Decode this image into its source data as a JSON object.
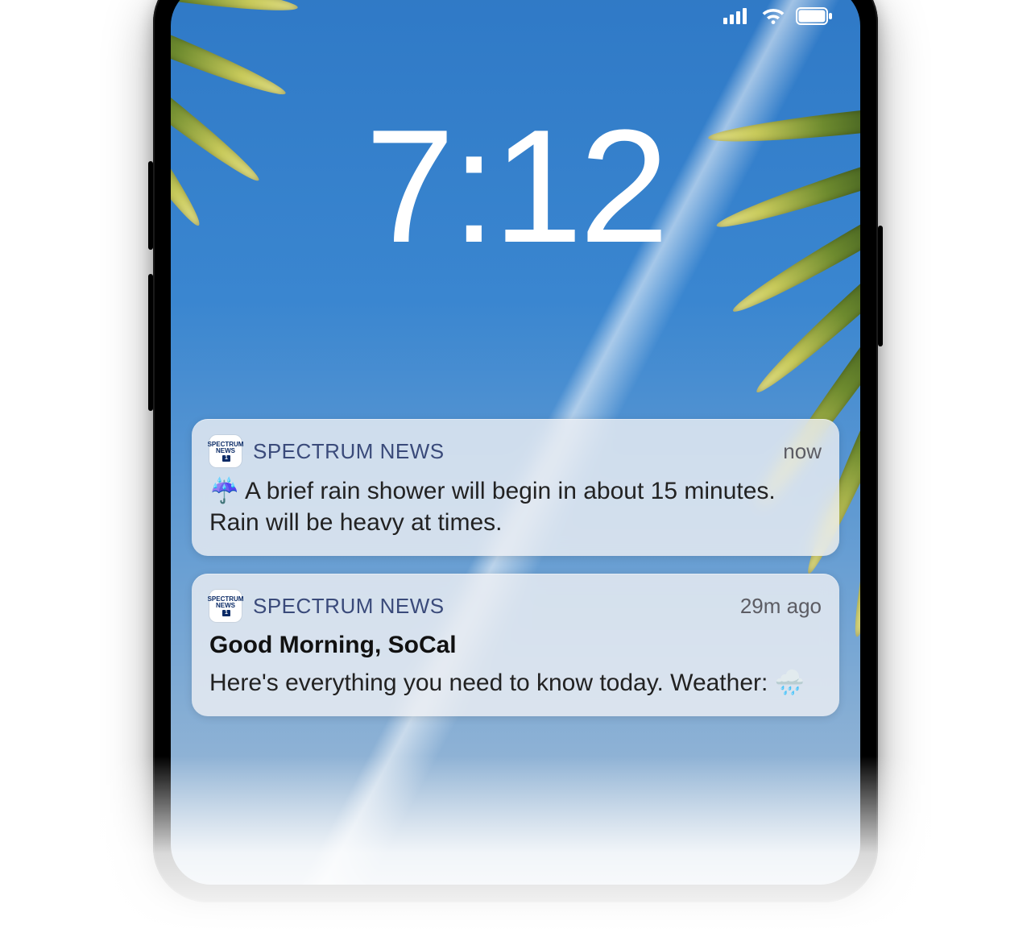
{
  "status_bar": {
    "signal_bars": 4,
    "wifi": true,
    "battery_full": true
  },
  "lock_screen": {
    "time": "7:12"
  },
  "notifications": [
    {
      "app_icon_label_line1": "SPECTRUM",
      "app_icon_label_line2": "NEWS",
      "app_icon_badge": "1",
      "app_name": "SPECTRUM NEWS",
      "time": "now",
      "title": "",
      "body": "☔ A brief rain shower will begin in about 15 minutes. Rain will be heavy at times."
    },
    {
      "app_icon_label_line1": "SPECTRUM",
      "app_icon_label_line2": "NEWS",
      "app_icon_badge": "1",
      "app_name": "SPECTRUM NEWS",
      "time": "29m ago",
      "title": "Good Morning, SoCal",
      "body": "Here's everything you need to know today. Weather: 🌧️"
    }
  ]
}
